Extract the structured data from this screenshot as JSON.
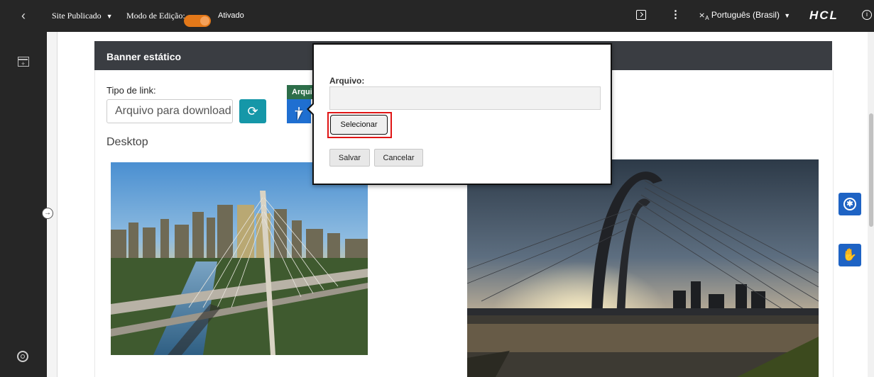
{
  "topbar": {
    "back_icon": "chevron-left-icon",
    "site_status": "Site Publicado",
    "edit_mode_label": "Modo de Edição:",
    "edit_mode_value": "Ativado",
    "language": "Português (Brasil)",
    "brand": "HCL",
    "accent_toggle": "#e37819"
  },
  "card": {
    "title": "Banner estático",
    "link_type_label": "Tipo de link:",
    "link_type_value": "Arquivo para download",
    "tag_label": "Arqui",
    "desktop_label": "Desktop"
  },
  "modal": {
    "file_label": "Arquivo:",
    "file_value": "",
    "select_button": "Selecionar",
    "save_button": "Salvar",
    "cancel_button": "Cancelar",
    "highlight_color": "#e01515"
  },
  "side": {
    "accessibility_icon": "accessibility-icon",
    "sign_language_icon": "sign-language-icon"
  }
}
